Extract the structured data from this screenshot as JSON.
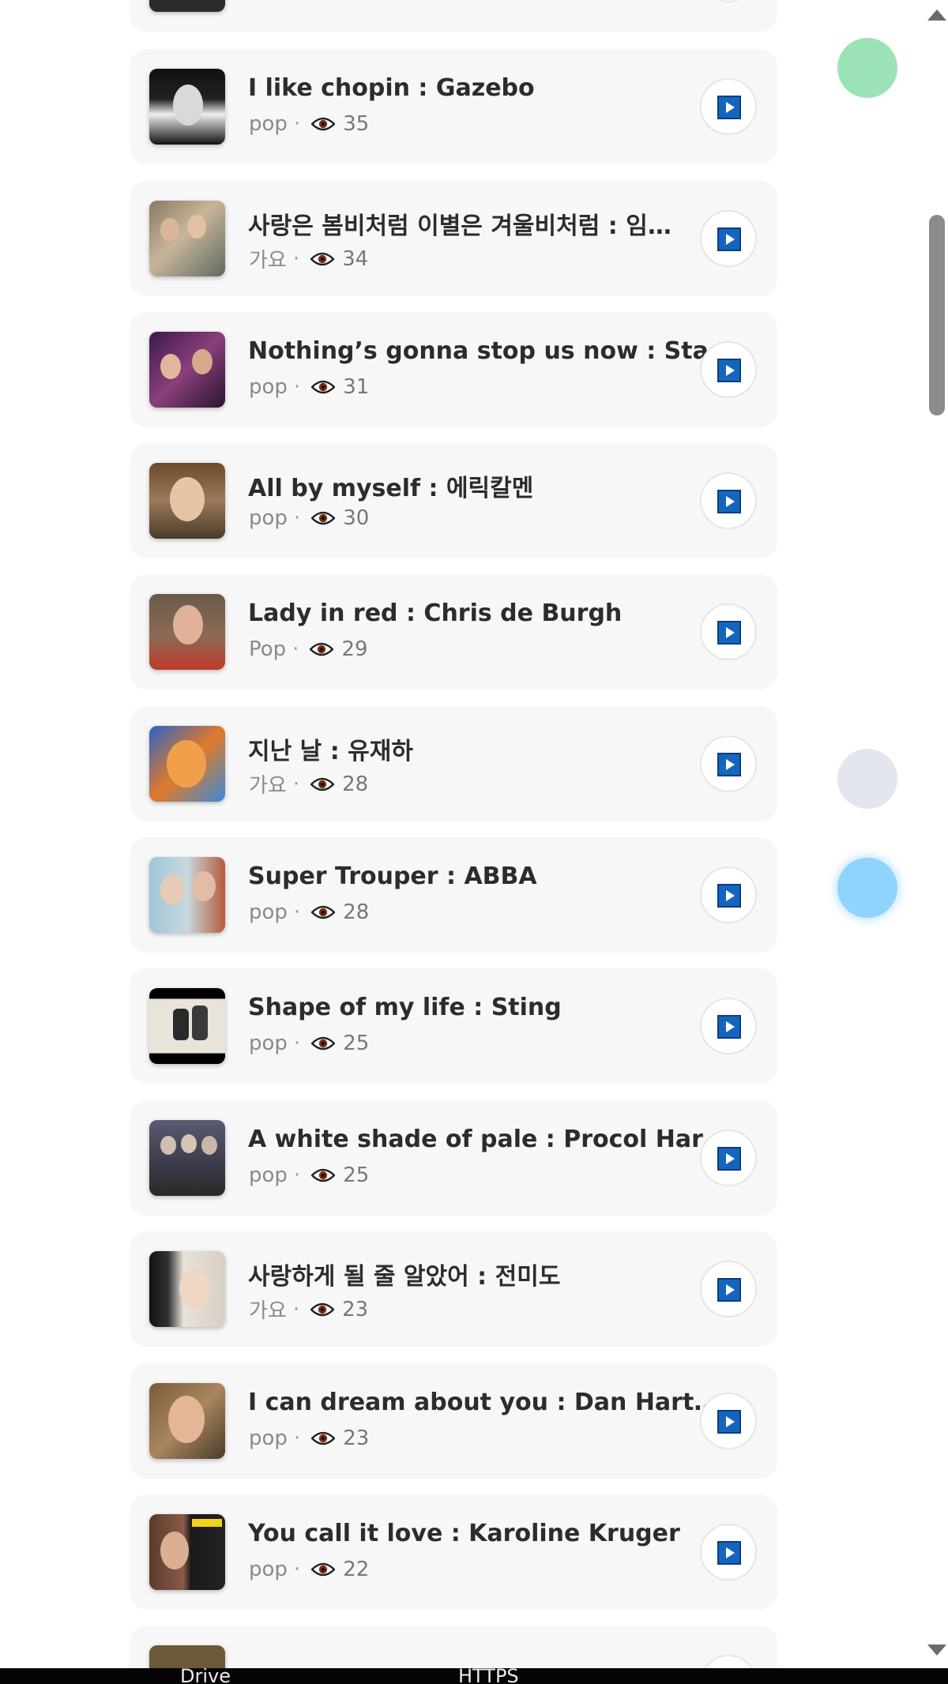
{
  "colors": {
    "card_bg": "#f7f7f8",
    "title": "#2c2c2c",
    "meta": "#8a8a8a",
    "play_icon": "#1565c0",
    "dot_green": "#9be3b6",
    "dot_gray": "#e3e6ee",
    "dot_blue": "#8fd3ff"
  },
  "songs": [
    {
      "title": "I like chopin : Gazebo",
      "genre": "pop",
      "views": "35"
    },
    {
      "title": "사랑은 봄비처럼 이별은 겨울비처럼 : 임…",
      "genre": "가요",
      "views": "34"
    },
    {
      "title": "Nothing’s gonna stop us now : Sta…",
      "genre": "pop",
      "views": "31"
    },
    {
      "title": "All by myself : 에릭칼멘",
      "genre": "pop",
      "views": "30"
    },
    {
      "title": "Lady in red : Chris de Burgh",
      "genre": "Pop",
      "views": "29"
    },
    {
      "title": "지난 날 : 유재하",
      "genre": "가요",
      "views": "28"
    },
    {
      "title": "Super Trouper : ABBA",
      "genre": "pop",
      "views": "28"
    },
    {
      "title": "Shape of my life : Sting",
      "genre": "pop",
      "views": "25"
    },
    {
      "title": "A white shade of pale : Procol Har…",
      "genre": "pop",
      "views": "25"
    },
    {
      "title": "사랑하게 될 줄 알았어 : 전미도",
      "genre": "가요",
      "views": "23"
    },
    {
      "title": "I can dream about you : Dan Hart…",
      "genre": "pop",
      "views": "23"
    },
    {
      "title": "You call it love : Karoline Kruger",
      "genre": "pop",
      "views": "22"
    }
  ],
  "meta_separator": "·",
  "taskbar": {
    "item1": "Drive",
    "item2": "HTTPS"
  },
  "icons": {
    "views": "eye-icon",
    "play": "play-icon"
  }
}
